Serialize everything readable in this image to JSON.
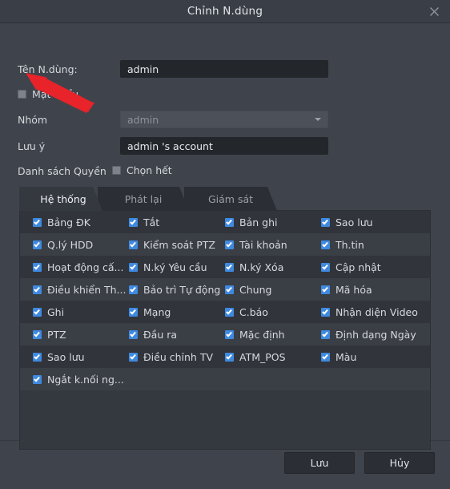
{
  "window": {
    "title": "Chỉnh N.dùng",
    "close_icon": "close-icon"
  },
  "form": {
    "username_label": "Tên N.dùng:",
    "username_value": "admin",
    "password_label": "Mật khẩu",
    "password_checked": false,
    "group_label": "Nhóm",
    "group_value": "admin",
    "note_label": "Lưu ý",
    "note_value": "admin 's account",
    "permission_list_label": "Danh sách Quyền",
    "select_all_label": "Chọn hết",
    "select_all_checked": false
  },
  "tabs": [
    {
      "label": "Hệ thống",
      "active": true
    },
    {
      "label": "Phát lại",
      "active": false
    },
    {
      "label": "Giám sát",
      "active": false
    }
  ],
  "permissions": [
    [
      "Bảng ĐK",
      "Tắt",
      "Bản ghi",
      "Sao lưu"
    ],
    [
      "Q.lý HDD",
      "Kiểm soát PTZ",
      "Tài khoản",
      "Th.tin"
    ],
    [
      "Hoạt động cấ...",
      "N.ký Yêu cầu",
      "N.ký Xóa",
      "Cập nhật"
    ],
    [
      "Điều khiển Th...",
      "Bảo trì Tự động",
      "Chung",
      "Mã hóa"
    ],
    [
      "Ghi",
      "Mạng",
      "C.báo",
      "Nhận diện Video"
    ],
    [
      "PTZ",
      "Đầu ra",
      "Mặc định",
      "Định dạng Ngày"
    ],
    [
      "Sao lưu",
      "Điều chỉnh TV",
      "ATM_POS",
      "Màu"
    ],
    [
      "Ngắt k.nối ng...",
      "",
      "",
      ""
    ]
  ],
  "footer": {
    "save_label": "Lưu",
    "cancel_label": "Hủy"
  },
  "colors": {
    "accent": "#3f8ae0",
    "window_bg": "#3f444c",
    "panel_bg": "#34383f",
    "input_bg": "#23262b",
    "annotation": "#e8232a"
  }
}
